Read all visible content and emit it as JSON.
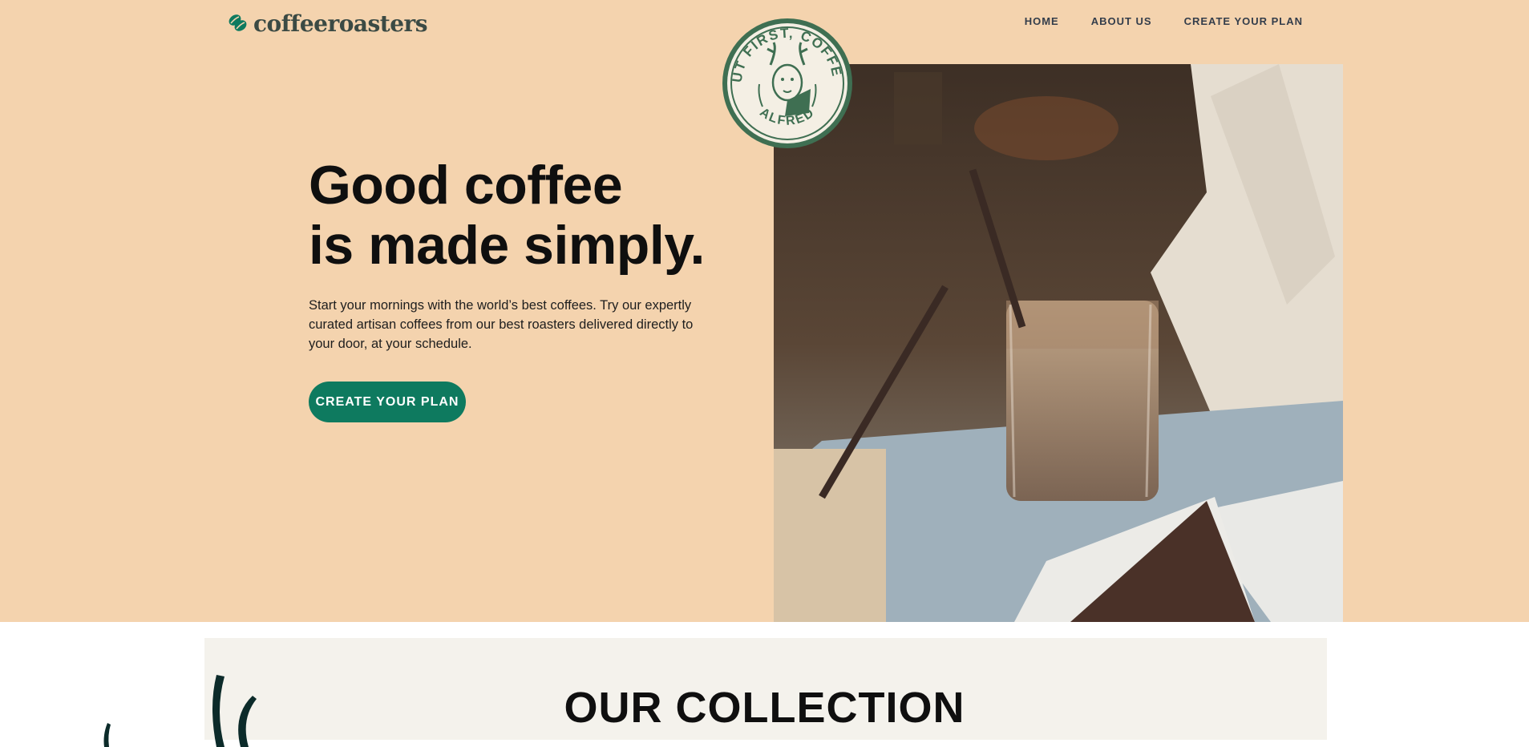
{
  "brand": {
    "name": "coffeeroasters",
    "logo_icon": "coffee-bean-icon",
    "accent": "#0e7a5f"
  },
  "nav": {
    "items": [
      "HOME",
      "ABOUT US",
      "CREATE YOUR PLAN"
    ]
  },
  "badge": {
    "top_text": "BUT FIRST, COFFEE.",
    "bottom_text": "ALFRED"
  },
  "hero": {
    "headline_line1": "Good coffee",
    "headline_line2": "is made simply.",
    "description": "Start your mornings with the world’s best coffees. Try our expertly curated artisan coffees from our best roasters delivered directly to your door, at your schedule.",
    "cta_label": "CREATE YOUR PLAN",
    "background": "#f4d3ae"
  },
  "collection": {
    "title": "OUR COLLECTION"
  }
}
